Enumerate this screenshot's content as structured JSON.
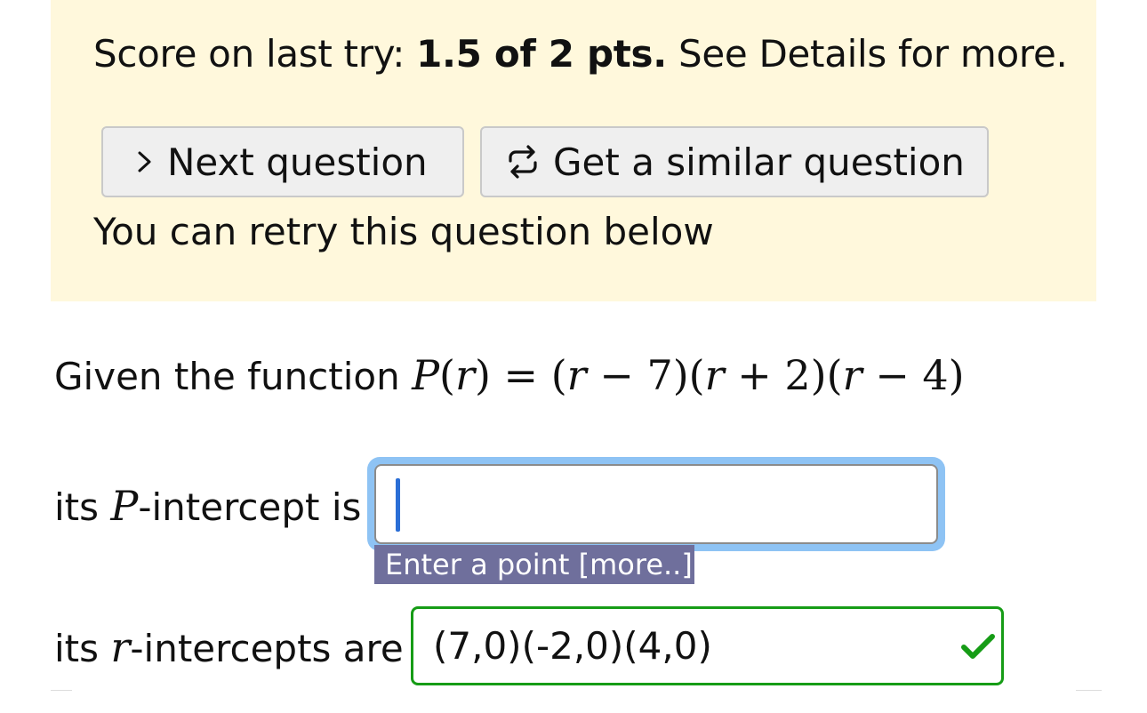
{
  "banner": {
    "score_prefix": "Score on last try: ",
    "score_value": "1.5 of 2 pts.",
    "score_suffix": " See Details for more.",
    "next_button_label": "Next question",
    "similar_button_label": "Get a similar question",
    "retry_text": "You can retry this question below"
  },
  "question": {
    "intro": "Given the function ",
    "function_name": "P",
    "variable": "r",
    "rhs_parts": [
      "(",
      "r",
      " − 7)(",
      "r",
      " + 2)(",
      "r",
      " − 4)"
    ]
  },
  "p_intercept": {
    "label_prefix": "its ",
    "label_var": "P",
    "label_suffix": "-intercept is",
    "value": "",
    "hint": "Enter a point [more..]"
  },
  "r_intercepts": {
    "label_prefix": "its ",
    "label_var": "r",
    "label_suffix": "-intercepts are",
    "value": "(7,0)(-2,0)(4,0)",
    "status": "correct"
  },
  "colors": {
    "banner_bg": "#fff8dc",
    "focus_ring": "#8ec3f4",
    "correct_green": "#169c16",
    "hint_bg": "#6f6f9c"
  },
  "icons": {
    "next": "chevron-right-icon",
    "similar": "repeat-arrows-icon",
    "correct": "checkmark-icon"
  }
}
